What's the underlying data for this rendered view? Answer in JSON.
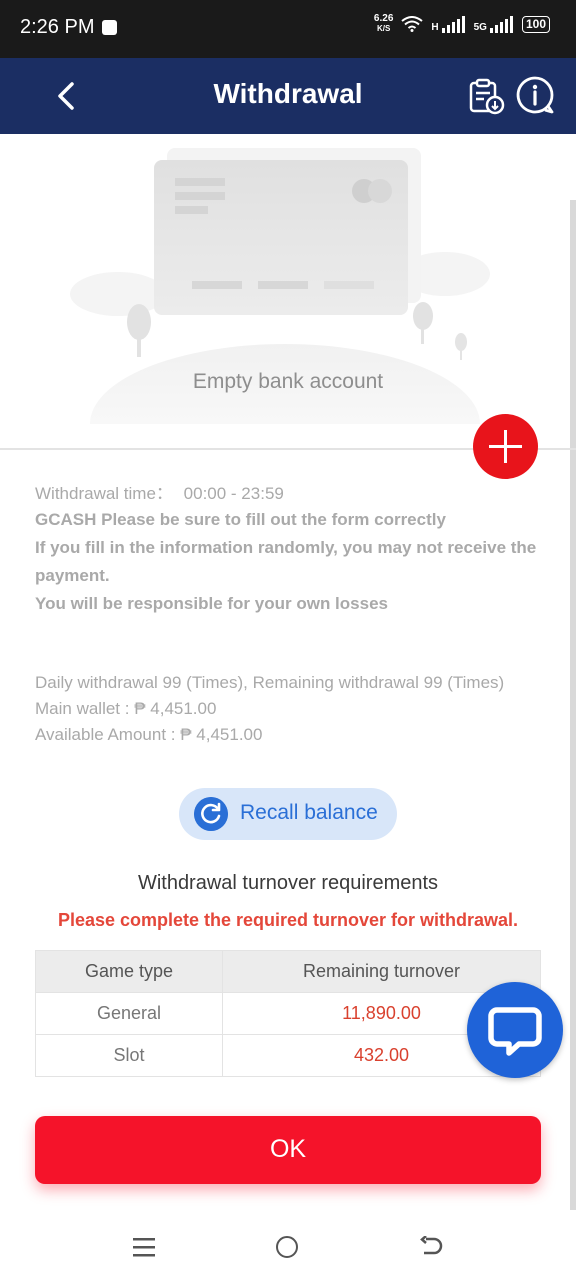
{
  "status_bar": {
    "time": "2:26 PM",
    "speed_value": "6.26",
    "speed_unit": "K/S",
    "network_h": "H",
    "network_5g": "5G",
    "battery": "100"
  },
  "header": {
    "title": "Withdrawal",
    "back_icon": "chevron-left-icon",
    "records_icon": "clipboard-download-icon",
    "help_icon": "info-bubble-icon"
  },
  "bank": {
    "empty_label": "Empty bank account",
    "add_icon": "plus-icon"
  },
  "info": {
    "time_label": "Withdrawal time：",
    "time_value": "00:00 - 23:59",
    "notice_line1": "GCASH Please be sure to fill out the form correctly",
    "notice_line2": "If you fill in the information randomly, you may not receive the payment.",
    "notice_line3": "You will be responsible for your own losses",
    "daily_limit": "Daily withdrawal 99 (Times), Remaining withdrawal 99 (Times)",
    "main_wallet": "Main wallet : ₱ 4,451.00",
    "available_amount": "Available Amount : ₱ 4,451.00"
  },
  "recall": {
    "label": "Recall balance",
    "icon": "refresh-icon"
  },
  "turnover": {
    "title": "Withdrawal turnover requirements",
    "warning": "Please complete the required turnover for withdrawal.",
    "columns": [
      "Game type",
      "Remaining turnover"
    ],
    "rows": [
      {
        "type": "General",
        "amount": "11,890.00"
      },
      {
        "type": "Slot",
        "amount": "432.00"
      }
    ]
  },
  "ok_label": "OK",
  "colors": {
    "header_bg": "#1b2e63",
    "accent_red": "#f5132a",
    "link_blue": "#2a6fd6"
  }
}
